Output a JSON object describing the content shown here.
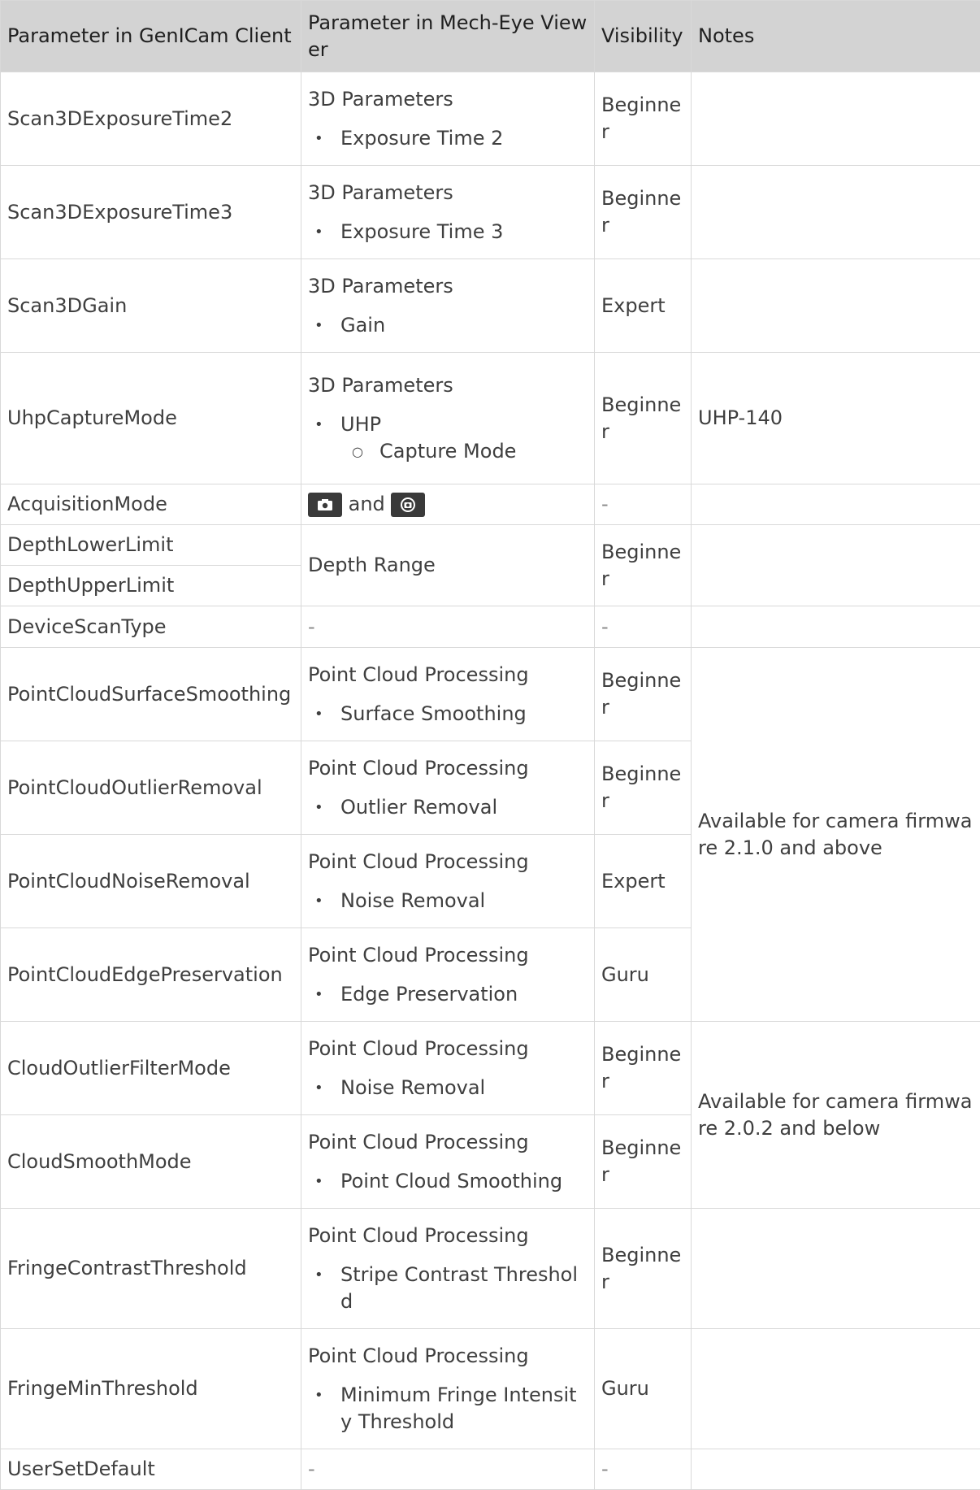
{
  "headers": [
    "Parameter in GenICam Client",
    "Parameter in Mech-Eye Viewer",
    "Visibility",
    "Notes"
  ],
  "rows": {
    "r1": {
      "param": "Scan3DExposureTime2",
      "group": "3D Parameters",
      "item": "Exposure Time 2",
      "vis": "Beginner"
    },
    "r2": {
      "param": "Scan3DExposureTime3",
      "group": "3D Parameters",
      "item": "Exposure Time 3",
      "vis": "Beginner"
    },
    "r3": {
      "param": "Scan3DGain",
      "group": "3D Parameters",
      "item": "Gain",
      "vis": "Expert"
    },
    "r4": {
      "param": "UhpCaptureMode",
      "group": "3D Parameters",
      "item": "UHP",
      "subitem": "Capture Mode",
      "vis": "Beginner",
      "note": "UHP-140"
    },
    "r5": {
      "param": "AcquisitionMode",
      "and": "and",
      "vis": "-",
      "icons": [
        "camera-capture-icon",
        "continuous-capture-icon"
      ]
    },
    "r6": {
      "param": "DepthLowerLimit",
      "viewer": "Depth Range",
      "vis": "Beginner"
    },
    "r7": {
      "param": "DepthUpperLimit"
    },
    "r8": {
      "param": "DeviceScanType",
      "viewer": "-",
      "vis": "-"
    },
    "r9": {
      "param": "PointCloudSurfaceSmoothing",
      "group": "Point Cloud Processing",
      "item": "Surface Smoothing",
      "vis": "Beginner",
      "note": "Available for camera firmware 2.1.0 and above"
    },
    "r10": {
      "param": "PointCloudOutlierRemoval",
      "group": "Point Cloud Processing",
      "item": "Outlier Removal",
      "vis": "Beginner"
    },
    "r11": {
      "param": "PointCloudNoiseRemoval",
      "group": "Point Cloud Processing",
      "item": "Noise Removal",
      "vis": "Expert"
    },
    "r12": {
      "param": "PointCloudEdgePreservation",
      "group": "Point Cloud Processing",
      "item": "Edge Preservation",
      "vis": "Guru"
    },
    "r13": {
      "param": "CloudOutlierFilterMode",
      "group": "Point Cloud Processing",
      "item": "Noise Removal",
      "vis": "Beginner",
      "note": "Available for camera firmware 2.0.2 and below"
    },
    "r14": {
      "param": "CloudSmoothMode",
      "group": "Point Cloud Processing",
      "item": "Point Cloud Smoothing",
      "vis": "Beginner"
    },
    "r15": {
      "param": "FringeContrastThreshold",
      "group": "Point Cloud Processing",
      "item": "Stripe Contrast Threshold",
      "vis": "Beginner"
    },
    "r16": {
      "param": "FringeMinThreshold",
      "group": "Point Cloud Processing",
      "item": "Minimum Fringe Intensity Threshold",
      "vis": "Guru"
    },
    "r17": {
      "param": "UserSetDefault",
      "viewer": "-",
      "vis": "-"
    }
  }
}
